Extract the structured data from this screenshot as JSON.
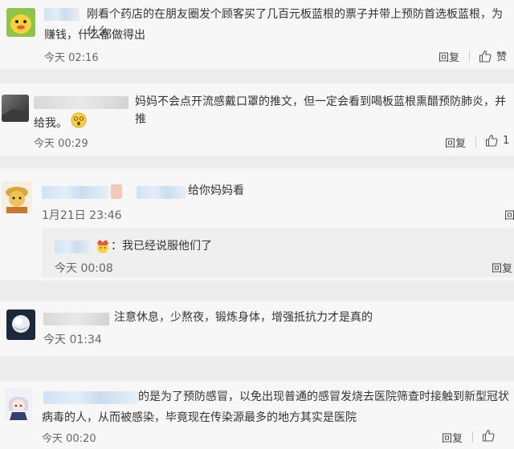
{
  "comments": [
    {
      "text_line1": "刚看个药店的在朋友圈发个顾客买了几百元板蓝根的票子并带上预防首选板蓝根，为什么",
      "text_line2": "赚钱，什么都做得出",
      "time": "今天 02:16",
      "reply_label": "回复",
      "like_label": "赞"
    },
    {
      "text_line1": "妈妈不会点开流感戴口罩的推文，但一定会看到喝板蓝根熏醋预防肺炎，并推",
      "text_line2": "给我。",
      "time": "今天 00:29",
      "reply_label": "回复",
      "like_count": "1"
    },
    {
      "text_line1": "给你妈妈看",
      "time": "1月21日 23:46",
      "reply_label": "回",
      "sub": {
        "text": "：我已经说服他们了",
        "time": "今天 00:08",
        "reply_label": "回复"
      }
    },
    {
      "text_line1": "注意休息，少熬夜，锻炼身体，增强抵抗力才是真的",
      "time": "今天 01:34"
    },
    {
      "text_line1": "的是为了预防感冒，以免出现普通的感冒发烧去医院筛查时接触到新型冠状",
      "text_line2": "病毒的人，从而被感染，毕竟现在传染源最多的地方其实是医院",
      "time": "今天 00:20",
      "reply_label": "回复"
    }
  ],
  "colors": {
    "link": "#5a8ec4",
    "text": "#333333",
    "meta": "#666666",
    "bg": "#f7f7f7",
    "gap": "#ececec"
  }
}
